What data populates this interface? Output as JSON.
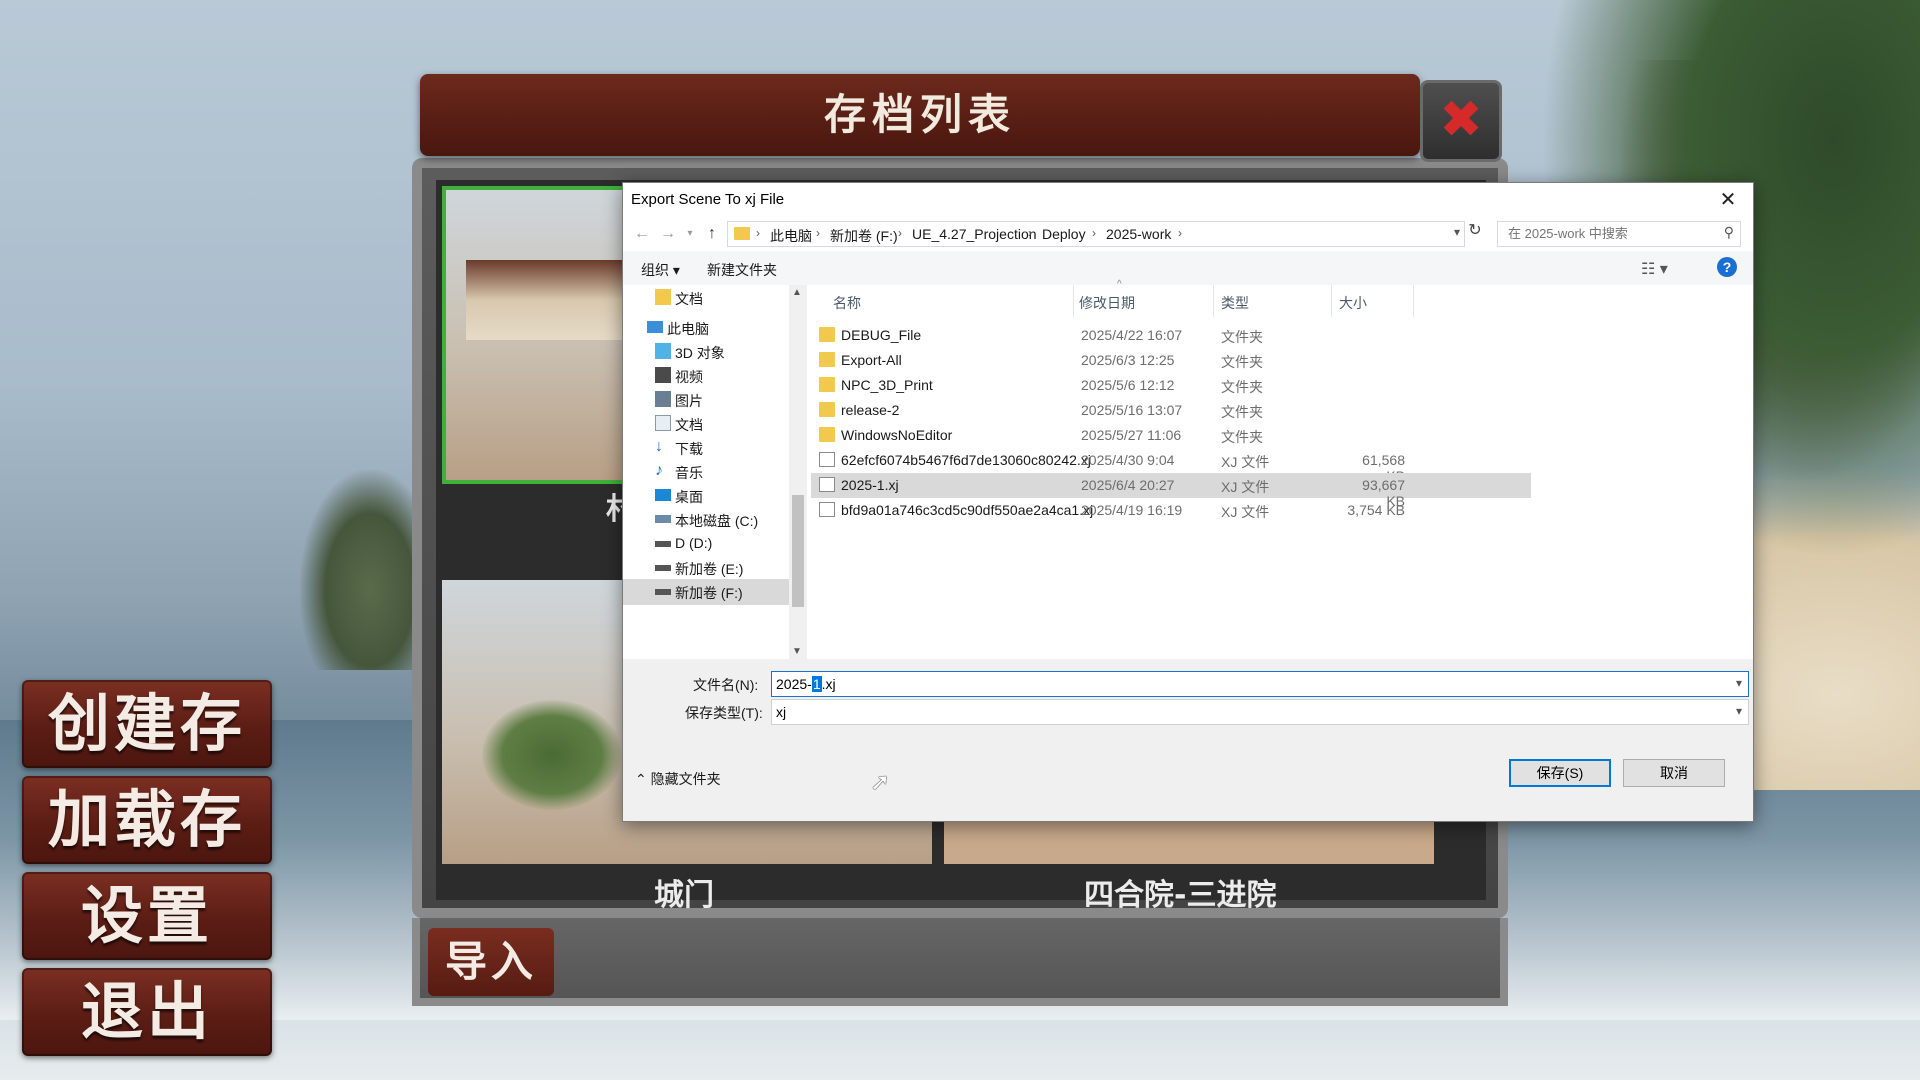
{
  "game_menu": {
    "create_save": "创建存档",
    "load_save": "加载存档",
    "settings": "设置",
    "exit": "退出"
  },
  "save_panel": {
    "title": "存档列表",
    "close_icon": "close-x-icon",
    "slots": [
      {
        "label": "村"
      },
      {
        "label": "城门"
      },
      {
        "label": "四合院-三进院"
      }
    ],
    "import_label": "导入"
  },
  "dialog": {
    "title": "Export Scene To xj File",
    "breadcrumb": [
      "此电脑",
      "新加卷 (F:)",
      "UE_4.27_Projection",
      "Deploy",
      "2025-work"
    ],
    "search_placeholder": "在 2025-work 中搜索",
    "toolbar": {
      "organize": "组织 ▾",
      "new_folder": "新建文件夹"
    },
    "nav_items": [
      {
        "label": "文档",
        "icon": "folder-icon"
      },
      {
        "label": "此电脑",
        "icon": "computer-icon"
      },
      {
        "label": "3D 对象",
        "icon": "3d-objects-icon"
      },
      {
        "label": "视频",
        "icon": "video-icon"
      },
      {
        "label": "图片",
        "icon": "pictures-icon"
      },
      {
        "label": "文档",
        "icon": "documents-icon"
      },
      {
        "label": "下载",
        "icon": "download-icon"
      },
      {
        "label": "音乐",
        "icon": "music-icon"
      },
      {
        "label": "桌面",
        "icon": "desktop-icon"
      },
      {
        "label": "本地磁盘 (C:)",
        "icon": "drive-icon"
      },
      {
        "label": "D (D:)",
        "icon": "drive-icon"
      },
      {
        "label": "新加卷 (E:)",
        "icon": "drive-icon"
      },
      {
        "label": "新加卷 (F:)",
        "icon": "drive-icon"
      }
    ],
    "columns": {
      "name": "名称",
      "date": "修改日期",
      "type": "类型",
      "size": "大小"
    },
    "files": [
      {
        "name": "DEBUG_File",
        "date": "2025/4/22 16:07",
        "type": "文件夹",
        "size": "",
        "kind": "folder"
      },
      {
        "name": "Export-All",
        "date": "2025/6/3 12:25",
        "type": "文件夹",
        "size": "",
        "kind": "folder"
      },
      {
        "name": "NPC_3D_Print",
        "date": "2025/5/6 12:12",
        "type": "文件夹",
        "size": "",
        "kind": "folder"
      },
      {
        "name": "release-2",
        "date": "2025/5/16 13:07",
        "type": "文件夹",
        "size": "",
        "kind": "folder"
      },
      {
        "name": "WindowsNoEditor",
        "date": "2025/5/27 11:06",
        "type": "文件夹",
        "size": "",
        "kind": "folder"
      },
      {
        "name": "62efcf6074b5467f6d7de13060c80242.xj",
        "date": "2025/4/30 9:04",
        "type": "XJ 文件",
        "size": "61,568 KB",
        "kind": "file"
      },
      {
        "name": "2025-1.xj",
        "date": "2025/6/4 20:27",
        "type": "XJ 文件",
        "size": "93,667 KB",
        "kind": "file"
      },
      {
        "name": "bfd9a01a746c3cd5c90df550ae2a4ca1.xj",
        "date": "2025/4/19 16:19",
        "type": "XJ 文件",
        "size": "3,754 KB",
        "kind": "file"
      }
    ],
    "filename_label": "文件名(N):",
    "filename_before": "2025-",
    "filename_selected": "1",
    "filename_after": ".xj",
    "filetype_label": "保存类型(T):",
    "filetype_value": "xj",
    "hide_folders": "隐藏文件夹",
    "save_button": "保存(S)",
    "cancel_button": "取消"
  }
}
